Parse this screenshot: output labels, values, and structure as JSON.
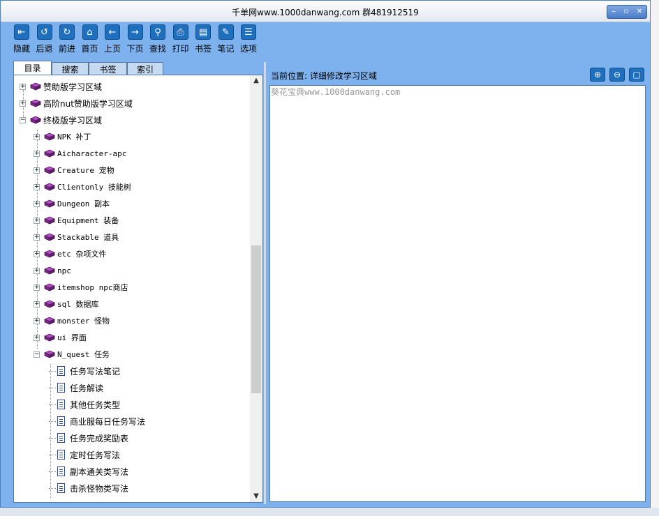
{
  "window": {
    "title": "千单网www.1000danwang.com 群481912519",
    "controls": [
      "‒",
      "▫",
      "✕"
    ]
  },
  "toolbar": [
    {
      "label": "隐藏",
      "icon": "hide-icon",
      "glyph": "⇤"
    },
    {
      "label": "后退",
      "icon": "back-icon",
      "glyph": "↺"
    },
    {
      "label": "前进",
      "icon": "forward-icon",
      "glyph": "↻"
    },
    {
      "label": "首页",
      "icon": "home-icon",
      "glyph": "⌂"
    },
    {
      "label": "上页",
      "icon": "prev-page-icon",
      "glyph": "←"
    },
    {
      "label": "下页",
      "icon": "next-page-icon",
      "glyph": "→"
    },
    {
      "label": "查找",
      "icon": "search-icon",
      "glyph": "⚲"
    },
    {
      "label": "打印",
      "icon": "print-icon",
      "glyph": "⎙"
    },
    {
      "label": "书签",
      "icon": "bookmark-icon",
      "glyph": "▤"
    },
    {
      "label": "笔记",
      "icon": "notes-icon",
      "glyph": "✎"
    },
    {
      "label": "选项",
      "icon": "options-icon",
      "glyph": "☰"
    }
  ],
  "tabs": [
    {
      "label": "目录",
      "active": true
    },
    {
      "label": "搜索",
      "active": false
    },
    {
      "label": "书签",
      "active": false
    },
    {
      "label": "索引",
      "active": false
    }
  ],
  "tree": [
    {
      "text": "赞助版学习区域",
      "type": "book",
      "expander": "+",
      "mono": false,
      "level": 0
    },
    {
      "text": "高阶nut赞助版学习区域",
      "type": "book",
      "expander": "+",
      "mono": false,
      "level": 0
    },
    {
      "text": "终极版学习区域",
      "type": "book",
      "expander": "-",
      "mono": false,
      "level": 0
    },
    {
      "text": "NPK  补丁",
      "type": "book",
      "expander": "+",
      "mono": true,
      "level": 1
    },
    {
      "text": "Aicharacter-apc",
      "type": "book",
      "expander": "+",
      "mono": true,
      "level": 1
    },
    {
      "text": "Creature 宠物",
      "type": "book",
      "expander": "+",
      "mono": true,
      "level": 1
    },
    {
      "text": "Clientonly  技能树",
      "type": "book",
      "expander": "+",
      "mono": true,
      "level": 1
    },
    {
      "text": "Dungeon 副本",
      "type": "book",
      "expander": "+",
      "mono": true,
      "level": 1
    },
    {
      "text": "Equipment 装备",
      "type": "book",
      "expander": "+",
      "mono": true,
      "level": 1
    },
    {
      "text": "Stackable  道具",
      "type": "book",
      "expander": "+",
      "mono": true,
      "level": 1
    },
    {
      "text": "etc 杂项文件",
      "type": "book",
      "expander": "+",
      "mono": true,
      "level": 1
    },
    {
      "text": "npc",
      "type": "book",
      "expander": "+",
      "mono": true,
      "level": 1
    },
    {
      "text": "itemshop  npc商店",
      "type": "book",
      "expander": "+",
      "mono": true,
      "level": 1
    },
    {
      "text": "sql  数据库",
      "type": "book",
      "expander": "+",
      "mono": true,
      "level": 1
    },
    {
      "text": "monster  怪物",
      "type": "book",
      "expander": "+",
      "mono": true,
      "level": 1
    },
    {
      "text": "ui  界面",
      "type": "book",
      "expander": "+",
      "mono": true,
      "level": 1
    },
    {
      "text": "N_quest  任务",
      "type": "book",
      "expander": "-",
      "mono": true,
      "level": 1
    },
    {
      "text": "任务写法笔记",
      "type": "doc",
      "expander": "",
      "mono": false,
      "level": 2
    },
    {
      "text": "任务解读",
      "type": "doc",
      "expander": "",
      "mono": false,
      "level": 2
    },
    {
      "text": "其他任务类型",
      "type": "doc",
      "expander": "",
      "mono": false,
      "level": 2
    },
    {
      "text": "商业服每日任务写法",
      "type": "doc",
      "expander": "",
      "mono": false,
      "level": 2
    },
    {
      "text": "任务完成奖励表",
      "type": "doc",
      "expander": "",
      "mono": false,
      "level": 2
    },
    {
      "text": "定时任务写法",
      "type": "doc",
      "expander": "",
      "mono": false,
      "level": 2
    },
    {
      "text": "副本通关类写法",
      "type": "doc",
      "expander": "",
      "mono": false,
      "level": 2
    },
    {
      "text": "击杀怪物类写法",
      "type": "doc",
      "expander": "",
      "mono": false,
      "level": 2
    }
  ],
  "scrollbar": {
    "up": "▲",
    "down": "▼"
  },
  "location": {
    "text": "当前位置: 详细修改学习区域"
  },
  "zoom": [
    {
      "name": "zoom-in-icon",
      "glyph": "⊕"
    },
    {
      "name": "zoom-out-icon",
      "glyph": "⊖"
    },
    {
      "name": "fullscreen-icon",
      "glyph": "▢"
    }
  ],
  "content": {
    "text": "葵花宝典www.1000danwang.com"
  },
  "colors": {
    "window_bg": "#7db2ef",
    "icon_blue": "#1f6fbf",
    "book_purple": "#7a2a8a"
  }
}
